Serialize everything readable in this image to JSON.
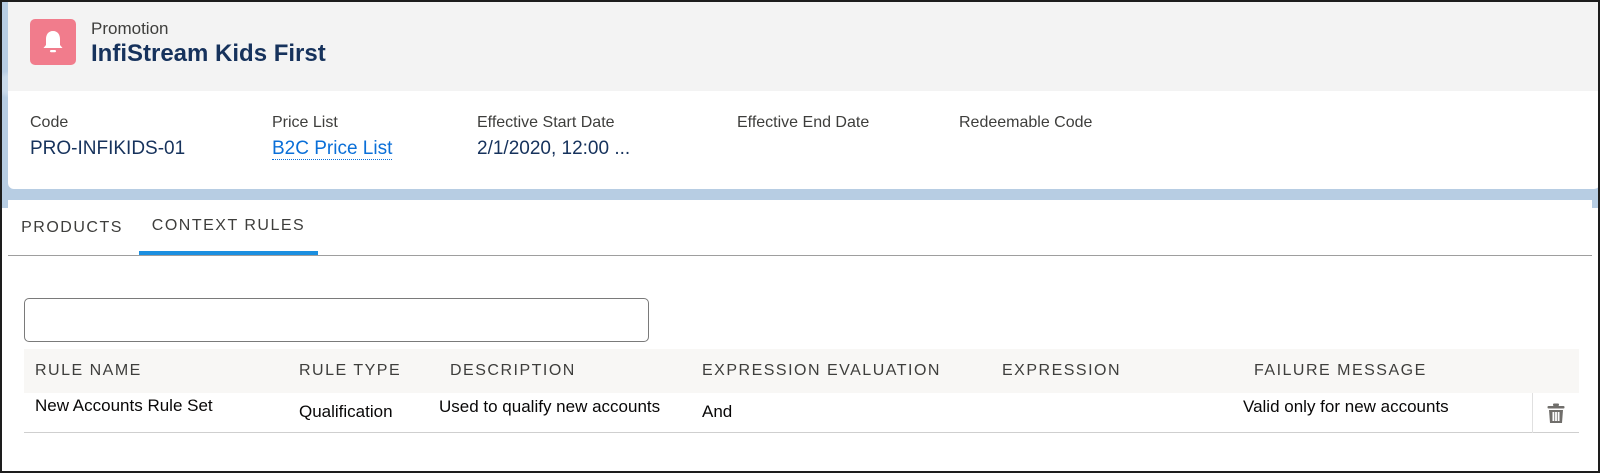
{
  "header": {
    "object_label": "Promotion",
    "record_title": "InfiStream Kids First",
    "icon": "bell-icon",
    "icon_color": "#f17c8c"
  },
  "fields": [
    {
      "label": "Code",
      "value": "PRO-INFIKIDS-01"
    },
    {
      "label": "Price List",
      "value": "B2C Price List"
    },
    {
      "label": "Effective Start Date",
      "value": "2/1/2020, 12:00 ..."
    },
    {
      "label": "Effective End Date",
      "value": ""
    },
    {
      "label": "Redeemable Code",
      "value": ""
    }
  ],
  "tabs": [
    {
      "label": "PRODUCTS",
      "active": false
    },
    {
      "label": "CONTEXT RULES",
      "active": true
    }
  ],
  "search": {
    "value": "",
    "placeholder": ""
  },
  "table": {
    "columns": [
      "RULE NAME",
      "RULE TYPE",
      "DESCRIPTION",
      "EXPRESSION EVALUATION",
      "EXPRESSION",
      "FAILURE MESSAGE"
    ],
    "rows": [
      {
        "rule_name": "New Accounts Rule Set",
        "rule_type": "Qualification",
        "description": "Used to qualify new accounts",
        "expression_evaluation": "And",
        "expression": "",
        "failure_message": "Valid only for new accounts"
      }
    ]
  },
  "colors": {
    "accent": "#1b8fe0",
    "link": "#0a6fd8",
    "title": "#16325c"
  }
}
